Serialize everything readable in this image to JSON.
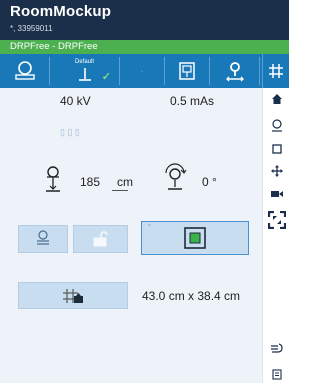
{
  "app": {
    "title": "RoomMockup",
    "subtitle": "*, 33959011"
  },
  "procedure": {
    "label": "DRPFree - DRPFree"
  },
  "toolbar": {
    "default_label": "Default",
    "items": [
      {
        "name": "detector-icon"
      },
      {
        "name": "default-position-icon"
      },
      {
        "name": "dot-icon"
      },
      {
        "name": "table-icon"
      },
      {
        "name": "move-person-icon"
      }
    ],
    "grid_button": "grid-icon"
  },
  "exposure": {
    "kv": "40 kV",
    "mas": "0.5 mAs",
    "focus_marks": "▯ ▯  ▯"
  },
  "geometry": {
    "sid_value": "185",
    "sid_unit": "cm",
    "rotation": "0 °"
  },
  "field": {
    "size": "43.0 cm x 38.4 cm"
  },
  "sidebar": {
    "items": [
      {
        "name": "home-icon"
      },
      {
        "name": "tube-icon"
      },
      {
        "name": "square-icon"
      },
      {
        "name": "move-icon"
      },
      {
        "name": "camera-icon"
      },
      {
        "name": "collimation-icon"
      },
      {
        "name": "hand-icon"
      },
      {
        "name": "notes-icon"
      }
    ]
  },
  "colors": {
    "header": "#1b2f4a",
    "green": "#4caf50",
    "toolbar": "#1979b8",
    "panel": "#eef3fa",
    "button": "#c9ddf1"
  }
}
